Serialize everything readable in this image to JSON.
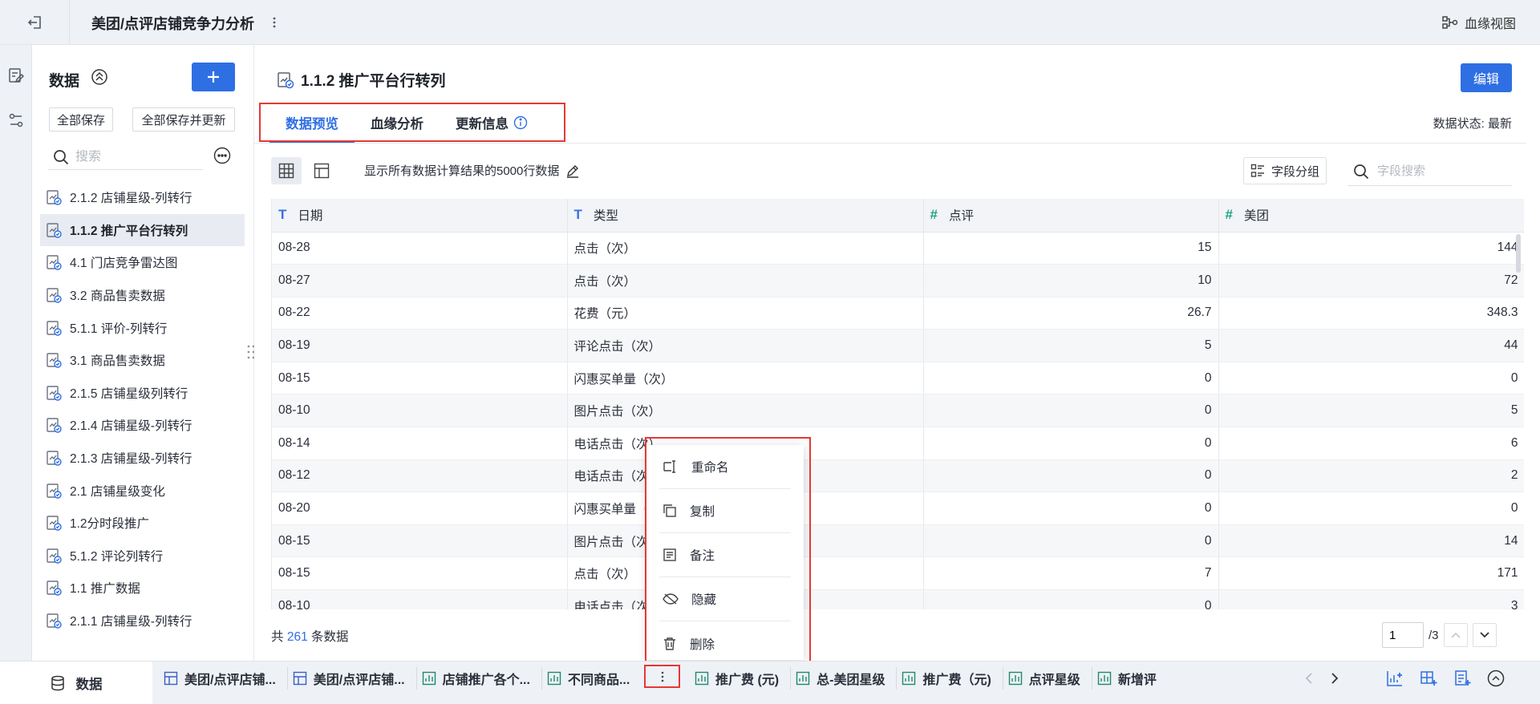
{
  "topbar": {
    "title": "美团/点评店铺竞争力分析",
    "lineage_view": "血缘视图"
  },
  "sidebar": {
    "title": "数据",
    "save_all": "全部保存",
    "save_all_update": "全部保存并更新",
    "search_placeholder": "搜索",
    "items": [
      {
        "label": "2.1.2 店铺星级-列转行",
        "active": false
      },
      {
        "label": "1.1.2 推广平台行转列",
        "active": true
      },
      {
        "label": "4.1 门店竞争雷达图",
        "active": false
      },
      {
        "label": "3.2 商品售卖数据",
        "active": false
      },
      {
        "label": "5.1.1 评价-列转行",
        "active": false
      },
      {
        "label": "3.1 商品售卖数据",
        "active": false
      },
      {
        "label": "2.1.5 店铺星级列转行",
        "active": false
      },
      {
        "label": "2.1.4 店铺星级-列转行",
        "active": false
      },
      {
        "label": "2.1.3 店铺星级-列转行",
        "active": false
      },
      {
        "label": "2.1 店铺星级变化",
        "active": false
      },
      {
        "label": "1.2分时段推广",
        "active": false
      },
      {
        "label": "5.1.2 评论列转行",
        "active": false
      },
      {
        "label": "1.1 推广数据",
        "active": false
      },
      {
        "label": "2.1.1 店铺星级-列转行",
        "active": false
      }
    ]
  },
  "main": {
    "title": "1.1.2 推广平台行转列",
    "edit": "编辑",
    "tabs": [
      {
        "label": "数据预览",
        "active": true
      },
      {
        "label": "血缘分析",
        "active": false
      },
      {
        "label": "更新信息",
        "active": false
      }
    ],
    "data_status": "数据状态: 最新",
    "toolbar": {
      "info": "显示所有数据计算结果的5000行数据",
      "field_group": "字段分组",
      "field_search_placeholder": "字段搜索"
    },
    "columns": [
      {
        "name": "日期",
        "type": "T"
      },
      {
        "name": "类型",
        "type": "T"
      },
      {
        "name": "点评",
        "type": "#"
      },
      {
        "name": "美团",
        "type": "#"
      }
    ],
    "rows": [
      [
        "08-28",
        "点击（次）",
        "15",
        "144"
      ],
      [
        "08-27",
        "点击（次）",
        "10",
        "72"
      ],
      [
        "08-22",
        "花费（元）",
        "26.7",
        "348.3"
      ],
      [
        "08-19",
        "评论点击（次）",
        "5",
        "44"
      ],
      [
        "08-15",
        "闪惠买单量（次）",
        "0",
        "0"
      ],
      [
        "08-10",
        "图片点击（次）",
        "0",
        "5"
      ],
      [
        "08-14",
        "电话点击（次）",
        "0",
        "6"
      ],
      [
        "08-12",
        "电话点击（次",
        "0",
        "2"
      ],
      [
        "08-20",
        "闪惠买单量（",
        "0",
        "0"
      ],
      [
        "08-15",
        "图片点击（次",
        "0",
        "14"
      ],
      [
        "08-15",
        "点击（次）",
        "7",
        "171"
      ],
      [
        "08-10",
        "电话点击（次",
        "0",
        "3"
      ]
    ],
    "total_prefix": "共",
    "total_count": "261",
    "total_suffix": "条数据",
    "page_current": "1",
    "page_total": "/3"
  },
  "context_menu": {
    "items": [
      {
        "label": "重命名",
        "icon": "rename-icon"
      },
      {
        "label": "复制",
        "icon": "copy-icon"
      },
      {
        "label": "备注",
        "icon": "note-icon"
      },
      {
        "label": "隐藏",
        "icon": "hide-icon"
      },
      {
        "label": "删除",
        "icon": "delete-icon"
      }
    ]
  },
  "bottombar": {
    "data_tab": "数据",
    "tabs_left": [
      {
        "label": "美团/点评店铺...",
        "icon": "dashboard-icon"
      },
      {
        "label": "美团/点评店铺...",
        "icon": "dashboard-icon"
      },
      {
        "label": "店铺推广各个...",
        "icon": "chart-icon"
      },
      {
        "label": "不同商品...",
        "icon": "chart-icon"
      }
    ],
    "tabs_right": [
      {
        "label": "推广费 (元)",
        "icon": "chart-icon"
      },
      {
        "label": "总-美团星级",
        "icon": "chart-icon"
      },
      {
        "label": "推广费（元)",
        "icon": "chart-icon"
      },
      {
        "label": "点评星级",
        "icon": "chart-icon"
      },
      {
        "label": "新增评",
        "icon": "chart-icon"
      }
    ]
  },
  "colors": {
    "accent": "#2f6fe4",
    "highlight_border": "#e53935",
    "number_type": "#1fa385"
  }
}
